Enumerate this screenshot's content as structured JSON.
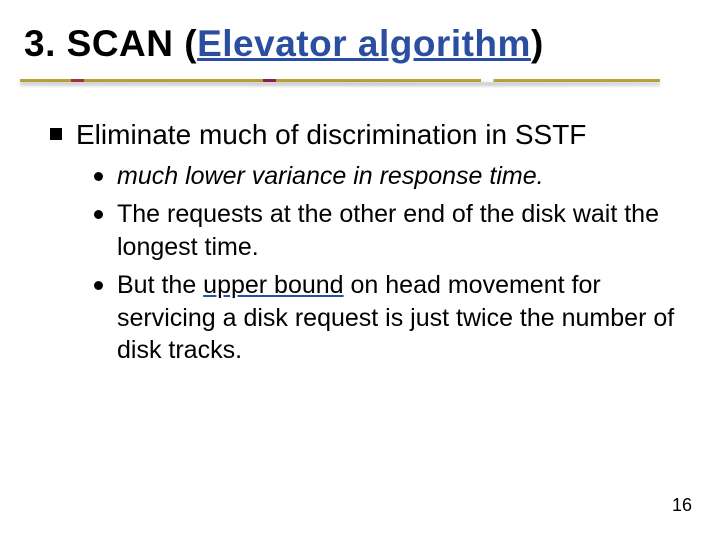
{
  "title": {
    "prefix": "3. SCAN (",
    "link_text": "Elevator algorithm",
    "suffix": ")"
  },
  "bullets": {
    "l1": "Eliminate much of discrimination in SSTF",
    "sub": [
      {
        "text": "much lower variance in response time.",
        "italic": true
      },
      {
        "text_a": "The requests at the other end of the disk wait the longest time."
      },
      {
        "text_b_pre": "But the ",
        "underline": "upper bound",
        "text_b_post": " on head movement for servicing a disk request is just twice the number of disk tracks."
      }
    ]
  },
  "page_number": "16"
}
